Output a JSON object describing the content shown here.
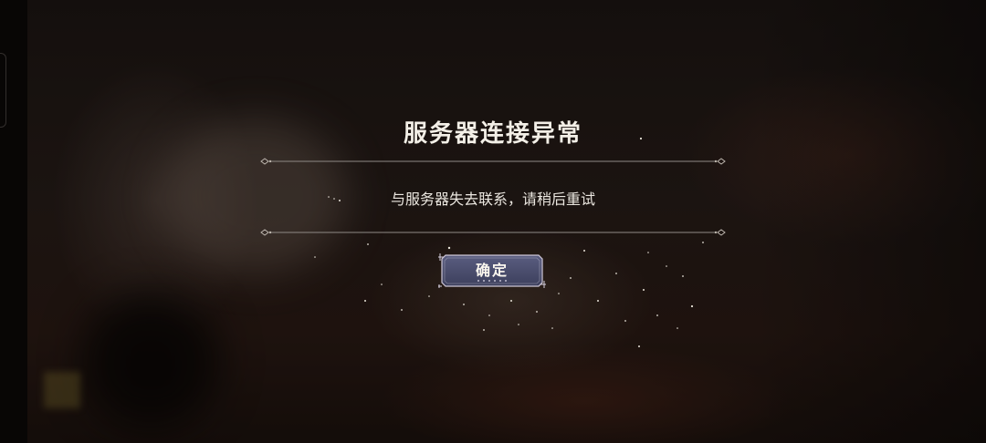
{
  "dialog": {
    "title": "服务器连接异常",
    "message": "与服务器失去联系，请稍后重试",
    "confirm_label": "确定"
  },
  "colors": {
    "text": "#f3efe7",
    "divider": "#8f8a86",
    "button_fill": "#4a4d6e",
    "button_border": "#cfc8d8"
  }
}
